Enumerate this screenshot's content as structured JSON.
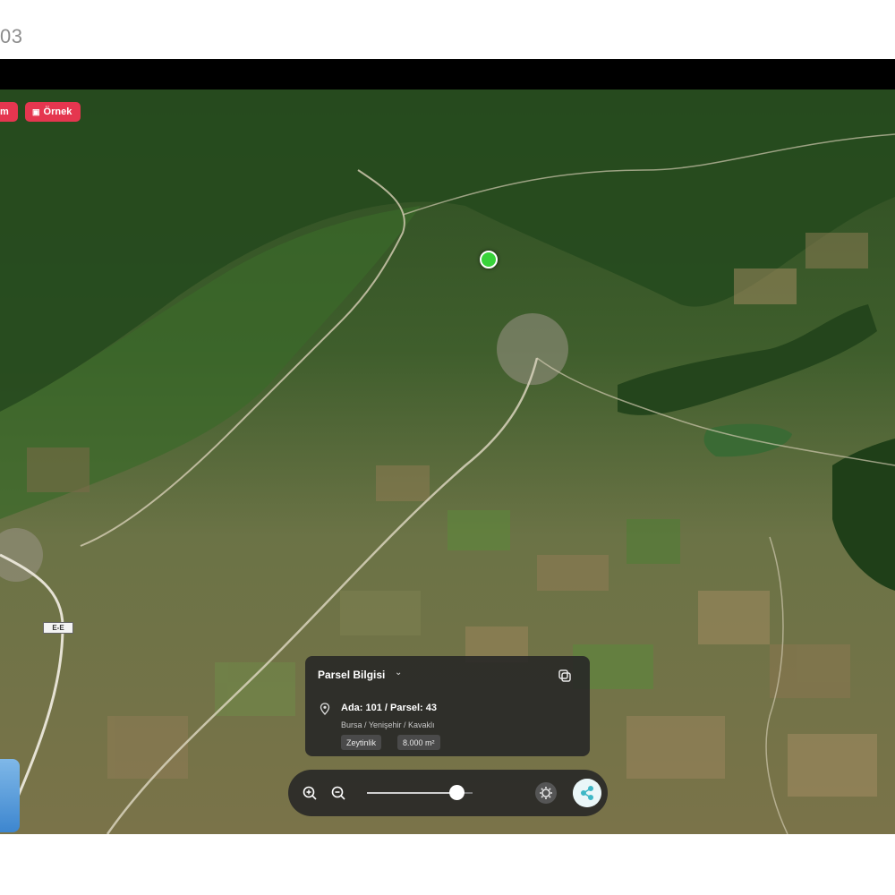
{
  "page": {
    "top_label": "03"
  },
  "map": {
    "tags": [
      {
        "label": "m"
      },
      {
        "icon": "camera-icon",
        "label": "Örnek"
      }
    ],
    "road_badge": "E-E",
    "marker_color": "#38d33a",
    "tag_color": "#e5364f"
  },
  "info_panel": {
    "title": "Parsel Bilgisi",
    "ada_parsel": "Ada: 101 / Parsel: 43",
    "location": "Bursa / Yenişehir / Kavaklı",
    "land_type": "Zeytinlik",
    "area": "8.000 m²"
  },
  "toolbar": {
    "zoom_level_fraction": 0.85,
    "share_color": "#3fb7c6"
  }
}
